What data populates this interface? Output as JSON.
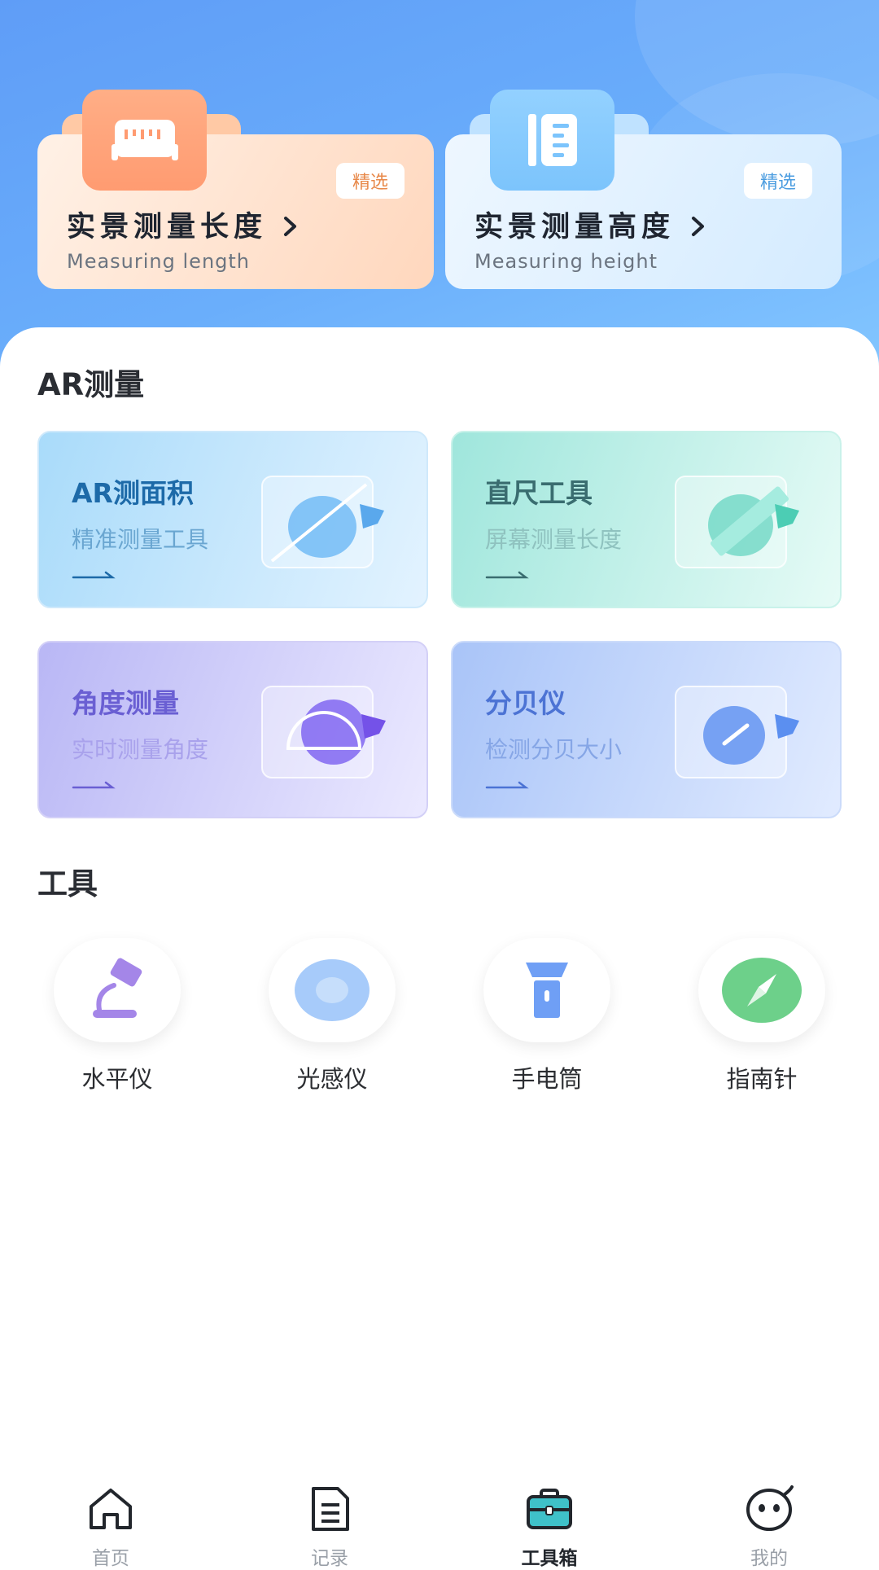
{
  "featured": [
    {
      "title": "实景测量长度",
      "subtitle": "Measuring length",
      "badge": "精选",
      "icon": "tape-measure-icon"
    },
    {
      "title": "实景测量高度",
      "subtitle": "Measuring height",
      "badge": "精选",
      "icon": "height-ruler-icon"
    }
  ],
  "ar_section": {
    "title": "AR测量",
    "cards": [
      {
        "title": "AR测面积",
        "subtitle": "精准测量工具",
        "icon": "area-measure-icon"
      },
      {
        "title": "直尺工具",
        "subtitle": "屏幕测量长度",
        "icon": "ruler-icon"
      },
      {
        "title": "角度测量",
        "subtitle": "实时测量角度",
        "icon": "protractor-icon"
      },
      {
        "title": "分贝仪",
        "subtitle": "检测分贝大小",
        "icon": "decibel-meter-icon"
      }
    ]
  },
  "tools_section": {
    "title": "工具",
    "items": [
      {
        "label": "水平仪",
        "icon": "level-icon"
      },
      {
        "label": "光感仪",
        "icon": "light-sensor-icon"
      },
      {
        "label": "手电筒",
        "icon": "flashlight-icon"
      },
      {
        "label": "指南针",
        "icon": "compass-icon"
      }
    ]
  },
  "tabbar": {
    "items": [
      {
        "label": "首页",
        "icon": "home-icon",
        "active": false
      },
      {
        "label": "记录",
        "icon": "records-icon",
        "active": false
      },
      {
        "label": "工具箱",
        "icon": "toolbox-icon",
        "active": true
      },
      {
        "label": "我的",
        "icon": "profile-icon",
        "active": false
      }
    ]
  },
  "colors": {
    "hero_blue": "#5f9df7",
    "accent_orange": "#e8894a",
    "compass_green": "#6dd08a"
  }
}
